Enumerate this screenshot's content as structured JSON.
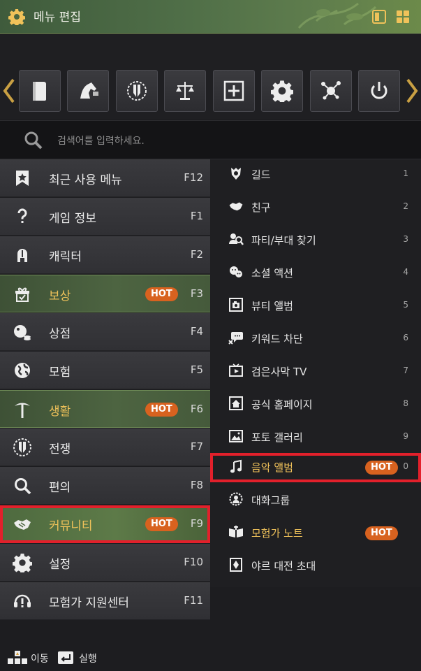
{
  "header": {
    "title": "메뉴 편집"
  },
  "quickbar": {
    "icons": [
      "book-icon",
      "horse-icon",
      "war-emblem-icon",
      "scale-icon",
      "plus-square-icon",
      "gear-icon",
      "node-network-icon",
      "power-icon"
    ]
  },
  "search": {
    "placeholder": "검색어를 입력하세요."
  },
  "categories": [
    {
      "label": "최근 사용 메뉴",
      "key": "F12",
      "icon": "star-bookmark-icon"
    },
    {
      "label": "게임 정보",
      "key": "F1",
      "icon": "question-icon"
    },
    {
      "label": "캐릭터",
      "key": "F2",
      "icon": "helmet-icon"
    },
    {
      "label": "보상",
      "key": "F3",
      "icon": "gift-check-icon",
      "badge": "HOT"
    },
    {
      "label": "상점",
      "key": "F4",
      "icon": "shop-coin-icon"
    },
    {
      "label": "모험",
      "key": "F5",
      "icon": "globe-icon"
    },
    {
      "label": "생활",
      "key": "F6",
      "icon": "pickaxe-icon",
      "badge": "HOT"
    },
    {
      "label": "전쟁",
      "key": "F7",
      "icon": "war-emblem-icon"
    },
    {
      "label": "편의",
      "key": "F8",
      "icon": "magnifier-icon"
    },
    {
      "label": "커뮤니티",
      "key": "F9",
      "icon": "handshake-icon",
      "badge": "HOT"
    },
    {
      "label": "설정",
      "key": "F10",
      "icon": "gear-icon"
    },
    {
      "label": "모험가 지원센터",
      "key": "F11",
      "icon": "headset-icon"
    }
  ],
  "submenu": [
    {
      "label": "길드",
      "key": "1",
      "icon": "guild-crest-icon"
    },
    {
      "label": "친구",
      "key": "2",
      "icon": "handshake-icon"
    },
    {
      "label": "파티/부대 찾기",
      "key": "3",
      "icon": "party-search-icon"
    },
    {
      "label": "소셜 액션",
      "key": "4",
      "icon": "emote-icon"
    },
    {
      "label": "뷰티 앨범",
      "key": "5",
      "icon": "photo-frame-icon"
    },
    {
      "label": "키워드 차단",
      "key": "6",
      "icon": "chat-block-icon"
    },
    {
      "label": "검은사막 TV",
      "key": "7",
      "icon": "tv-play-icon"
    },
    {
      "label": "공식 홈페이지",
      "key": "8",
      "icon": "home-page-icon"
    },
    {
      "label": "포토 갤러리",
      "key": "9",
      "icon": "landscape-image-icon"
    },
    {
      "label": "음악 앨범",
      "key": "0",
      "icon": "music-note-icon",
      "badge": "HOT"
    },
    {
      "label": "대화그룹",
      "key": "",
      "icon": "chat-group-icon"
    },
    {
      "label": "모험가 노트",
      "key": "",
      "icon": "open-book-icon",
      "badge": "HOT"
    },
    {
      "label": "야르 대전 초대",
      "key": "",
      "icon": "card-invite-icon"
    }
  ],
  "footer": {
    "move_label": "이동",
    "execute_label": "실행"
  },
  "colors": {
    "accent_gold": "#f0c25a",
    "hot_badge": "#d8621f",
    "selection_outline": "#e2202b"
  }
}
